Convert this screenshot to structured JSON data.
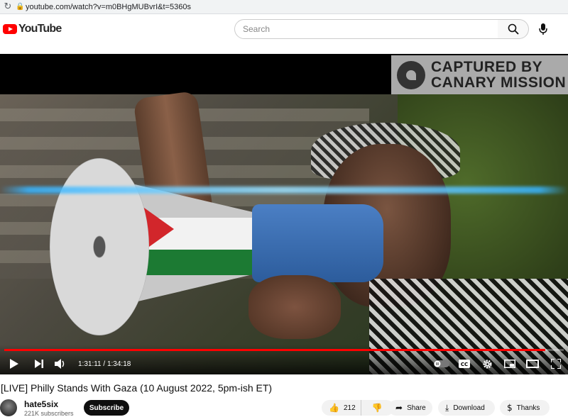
{
  "browser": {
    "url": "youtube.com/watch?v=m0BHgMUBvrI&t=5360s",
    "reload_icon": "reload-icon",
    "lock_icon": "lock-icon"
  },
  "header": {
    "logo_text": "YouTube",
    "search_placeholder": "Search",
    "search_icon": "search-icon",
    "mic_icon": "mic-icon"
  },
  "player": {
    "watermark_line1": "CAPTURED BY",
    "watermark_line2": "CANARY MISSION",
    "current_time": "1:31:11",
    "duration": "1:34:18",
    "time_display": "1:31:11 / 1:34:18",
    "progress": 0.967
  },
  "video": {
    "title": "[LIVE] Philly Stands With Gaza (10 August 2022, 5pm-ish ET)",
    "channel_name": "hate5six",
    "subscribers": "221K subscribers",
    "subscribe_label": "Subscribe",
    "likes": "212",
    "share_label": "Share",
    "download_label": "Download",
    "thanks_label": "Thanks"
  }
}
